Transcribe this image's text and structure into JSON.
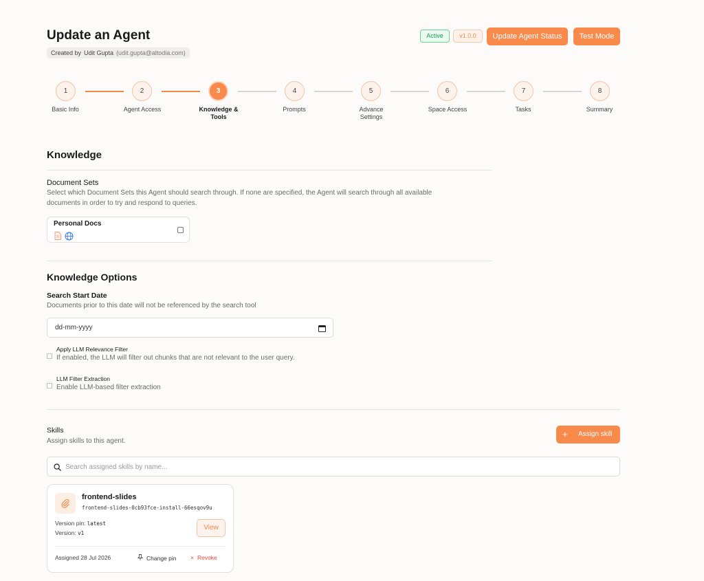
{
  "header": {
    "title": "Update an Agent",
    "created_by_label": "Created by",
    "created_by_name": "Udit Gupta",
    "created_by_email": "(udit.gupta@altodia.com)",
    "status_badge": "Active",
    "version_badge": "v1.0.0",
    "update_status_button": "Update Agent Status",
    "test_mode_button": "Test Mode"
  },
  "steps": [
    {
      "number": "1",
      "label": "Basic Info",
      "state": "done"
    },
    {
      "number": "2",
      "label": "Agent Access",
      "state": "done"
    },
    {
      "number": "3",
      "label": "Knowledge & Tools",
      "state": "active"
    },
    {
      "number": "4",
      "label": "Prompts",
      "state": "todo"
    },
    {
      "number": "5",
      "label": "Advance Settings",
      "state": "todo"
    },
    {
      "number": "6",
      "label": "Space Access",
      "state": "todo"
    },
    {
      "number": "7",
      "label": "Tasks",
      "state": "todo"
    },
    {
      "number": "8",
      "label": "Summary",
      "state": "todo"
    }
  ],
  "knowledge": {
    "heading": "Knowledge",
    "document_sets_label": "Document Sets",
    "document_sets_desc_line1": "Select which Document Sets this Agent should search through. If none are specified, the Agent will search through all available",
    "document_sets_desc_line2": "documents in order to try and respond to queries.",
    "doc_card_title": "Personal Docs",
    "doc_card_checked": false
  },
  "knowledge_options": {
    "heading": "Knowledge Options",
    "start_date_label": "Search Start Date",
    "start_date_desc": "Documents prior to this date will not be referenced by the search tool",
    "date_placeholder": "dd-mm-yyyy",
    "relevance_filter_title": "Apply LLM Relevance Filter",
    "relevance_filter_desc": "If enabled, the LLM will filter out chunks that are not relevant to the user query.",
    "filter_extraction_title": "LLM Filter Extraction",
    "filter_extraction_desc": "Enable LLM-based filter extraction"
  },
  "skills": {
    "heading": "Skills",
    "desc": "Assign skills to this agent.",
    "assign_button": "Assign skill",
    "search_placeholder": "Search assigned skills by name...",
    "card": {
      "name": "frontend-slides",
      "id": "frontend-slides-0cb93fce-install-66esqov9u",
      "version_pin_label": "Version pin:",
      "version_pin_value": "latest",
      "version_label": "Version:",
      "version_value": "v1",
      "view_button": "View",
      "assigned": "Assigned 28 Jul 2026",
      "change_pin": "Change pin",
      "revoke": "Revoke"
    }
  },
  "colors": {
    "accent": "#f88a4c",
    "active_green": "#23a052",
    "danger": "#e04a3f"
  }
}
